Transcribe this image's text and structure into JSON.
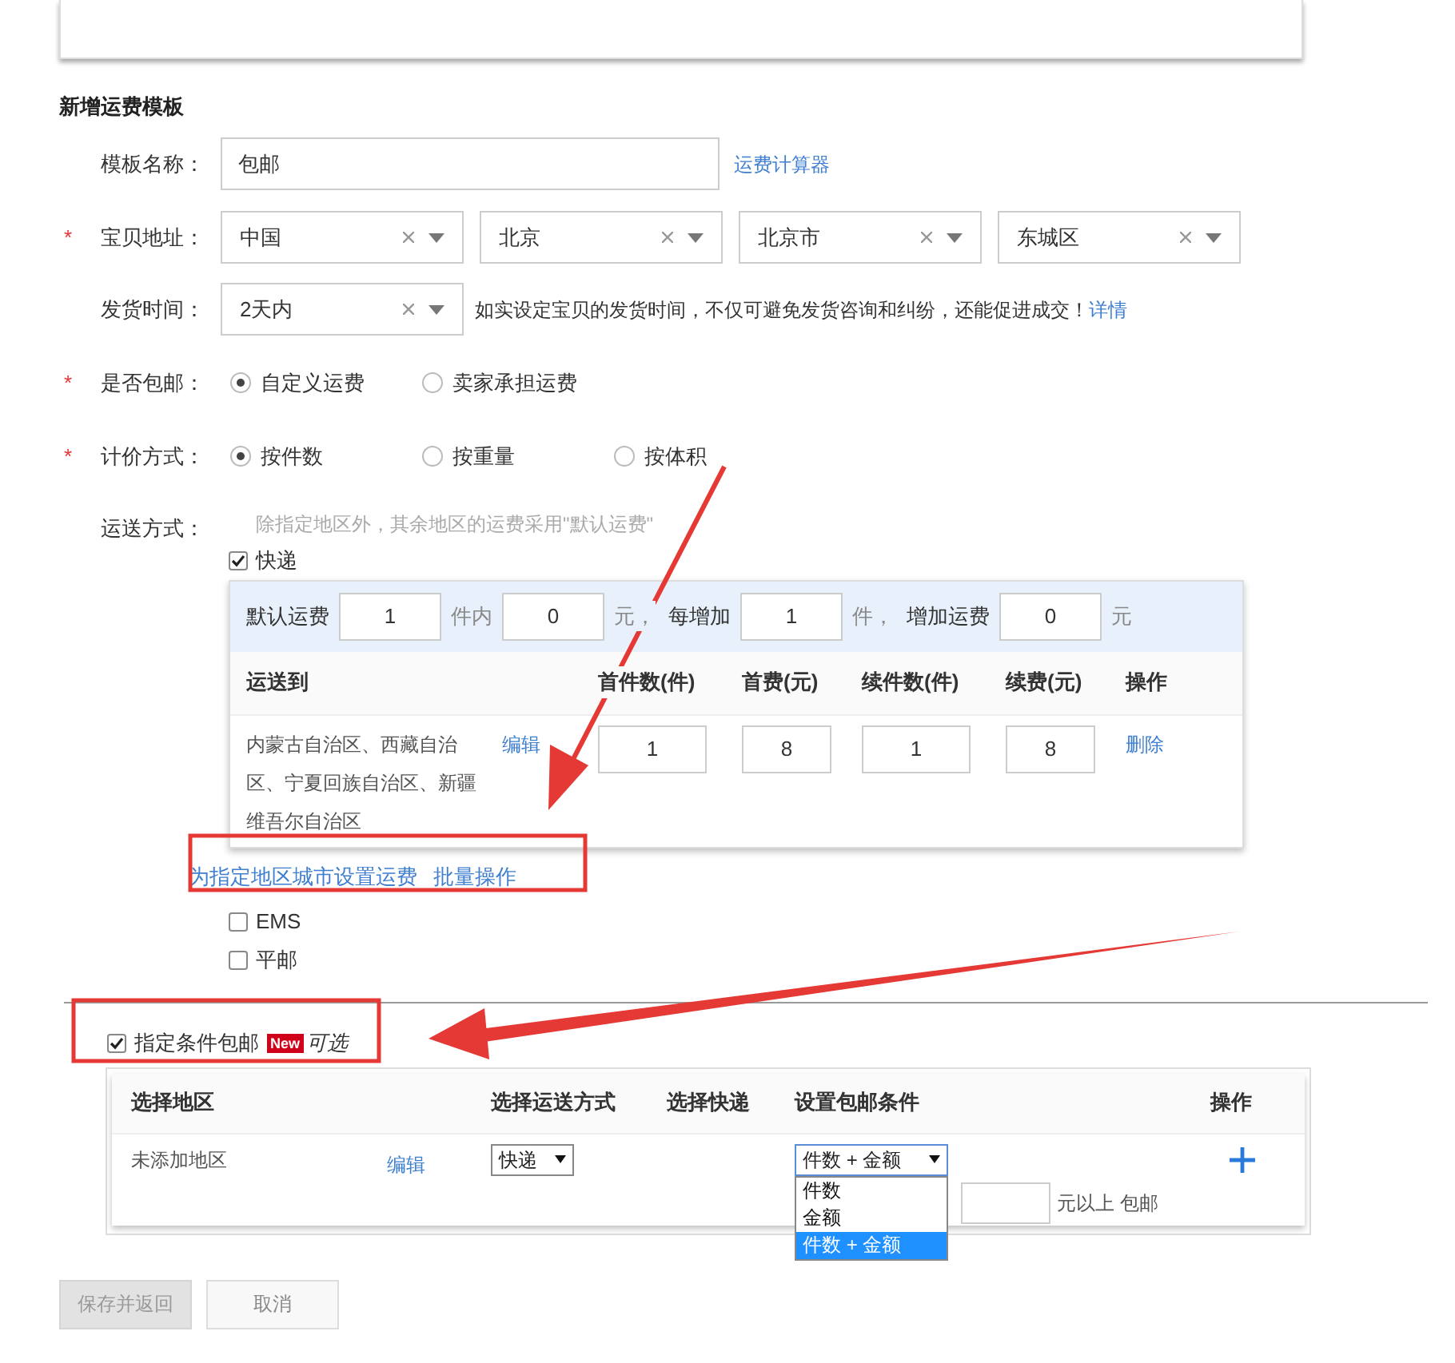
{
  "section_title": "新增运费模板",
  "template_name": {
    "label": "模板名称：",
    "value": "包邮",
    "link": "运费计算器"
  },
  "address": {
    "label": "宝贝地址：",
    "marker": "*",
    "selects": [
      "中国",
      "北京",
      "北京市",
      "东城区"
    ]
  },
  "ship_time": {
    "label": "发货时间：",
    "value": "2天内",
    "hint": "如实设定宝贝的发货时间，不仅可避免发货咨询和纠纷，还能促进成交！",
    "link": "详情"
  },
  "free_shipping_choice": {
    "label": "是否包邮：",
    "marker": "*",
    "options": [
      {
        "label": "自定义运费",
        "selected": true
      },
      {
        "label": "卖家承担运费",
        "selected": false
      }
    ]
  },
  "pricing": {
    "label": "计价方式：",
    "marker": "*",
    "options": [
      {
        "label": "按件数",
        "selected": true
      },
      {
        "label": "按重量",
        "selected": false
      },
      {
        "label": "按体积",
        "selected": false
      }
    ]
  },
  "delivery": {
    "label": "运送方式：",
    "hint": "除指定地区外，其余地区的运费采用\"默认运费\"",
    "methods": [
      {
        "label": "快递",
        "checked": true,
        "rates": {
          "default_fee": [
            {
              "kind": "text",
              "text": "默认运费"
            },
            {
              "kind": "input",
              "text": "1"
            },
            {
              "kind": "unit",
              "text": "件内"
            },
            {
              "kind": "input",
              "text": "0"
            },
            {
              "kind": "unit",
              "text": "元，"
            },
            {
              "kind": "text",
              "text": "每增加"
            },
            {
              "kind": "input",
              "text": "1"
            },
            {
              "kind": "unit",
              "text": "件，"
            },
            {
              "kind": "text",
              "text": "增加运费"
            },
            {
              "kind": "input",
              "text": "0"
            },
            {
              "kind": "unit",
              "text": "元"
            }
          ],
          "columns": [
            "运送到",
            "首件数(件)",
            "首费(元)",
            "续件数(件)",
            "续费(元)",
            "操作"
          ],
          "rows": [
            {
              "region": "内蒙古自治区、西藏自治区、宁夏回族自治区、新疆维吾尔自治区",
              "edit": "编辑",
              "values": [
                "1",
                "8",
                "1",
                "8"
              ],
              "action": "删除"
            }
          ],
          "links": [
            "为指定地区城市设置运费",
            "批量操作"
          ]
        }
      },
      {
        "label": "EMS",
        "checked": false
      },
      {
        "label": "平邮",
        "checked": false
      }
    ]
  },
  "conditional_free": {
    "checked": true,
    "label": "指定条件包邮",
    "badge": "New",
    "note": "可选",
    "columns": [
      "选择地区",
      "选择运送方式",
      "选择快递",
      "设置包邮条件",
      "操作"
    ],
    "rows": [
      {
        "region": "未添加地区",
        "edit": "编辑",
        "method": "快递",
        "condition": {
          "value": "件数 + 金额",
          "expanded": true,
          "options": [
            {
              "label": "件数",
              "selected": false
            },
            {
              "label": "金额",
              "selected": false
            },
            {
              "label": "件数 + 金额",
              "selected": true
            }
          ]
        },
        "suffix": "元以上 包邮"
      }
    ]
  },
  "buttons": [
    {
      "label": "保存并返回",
      "disabled": true
    },
    {
      "label": "取消",
      "disabled": false
    }
  ]
}
